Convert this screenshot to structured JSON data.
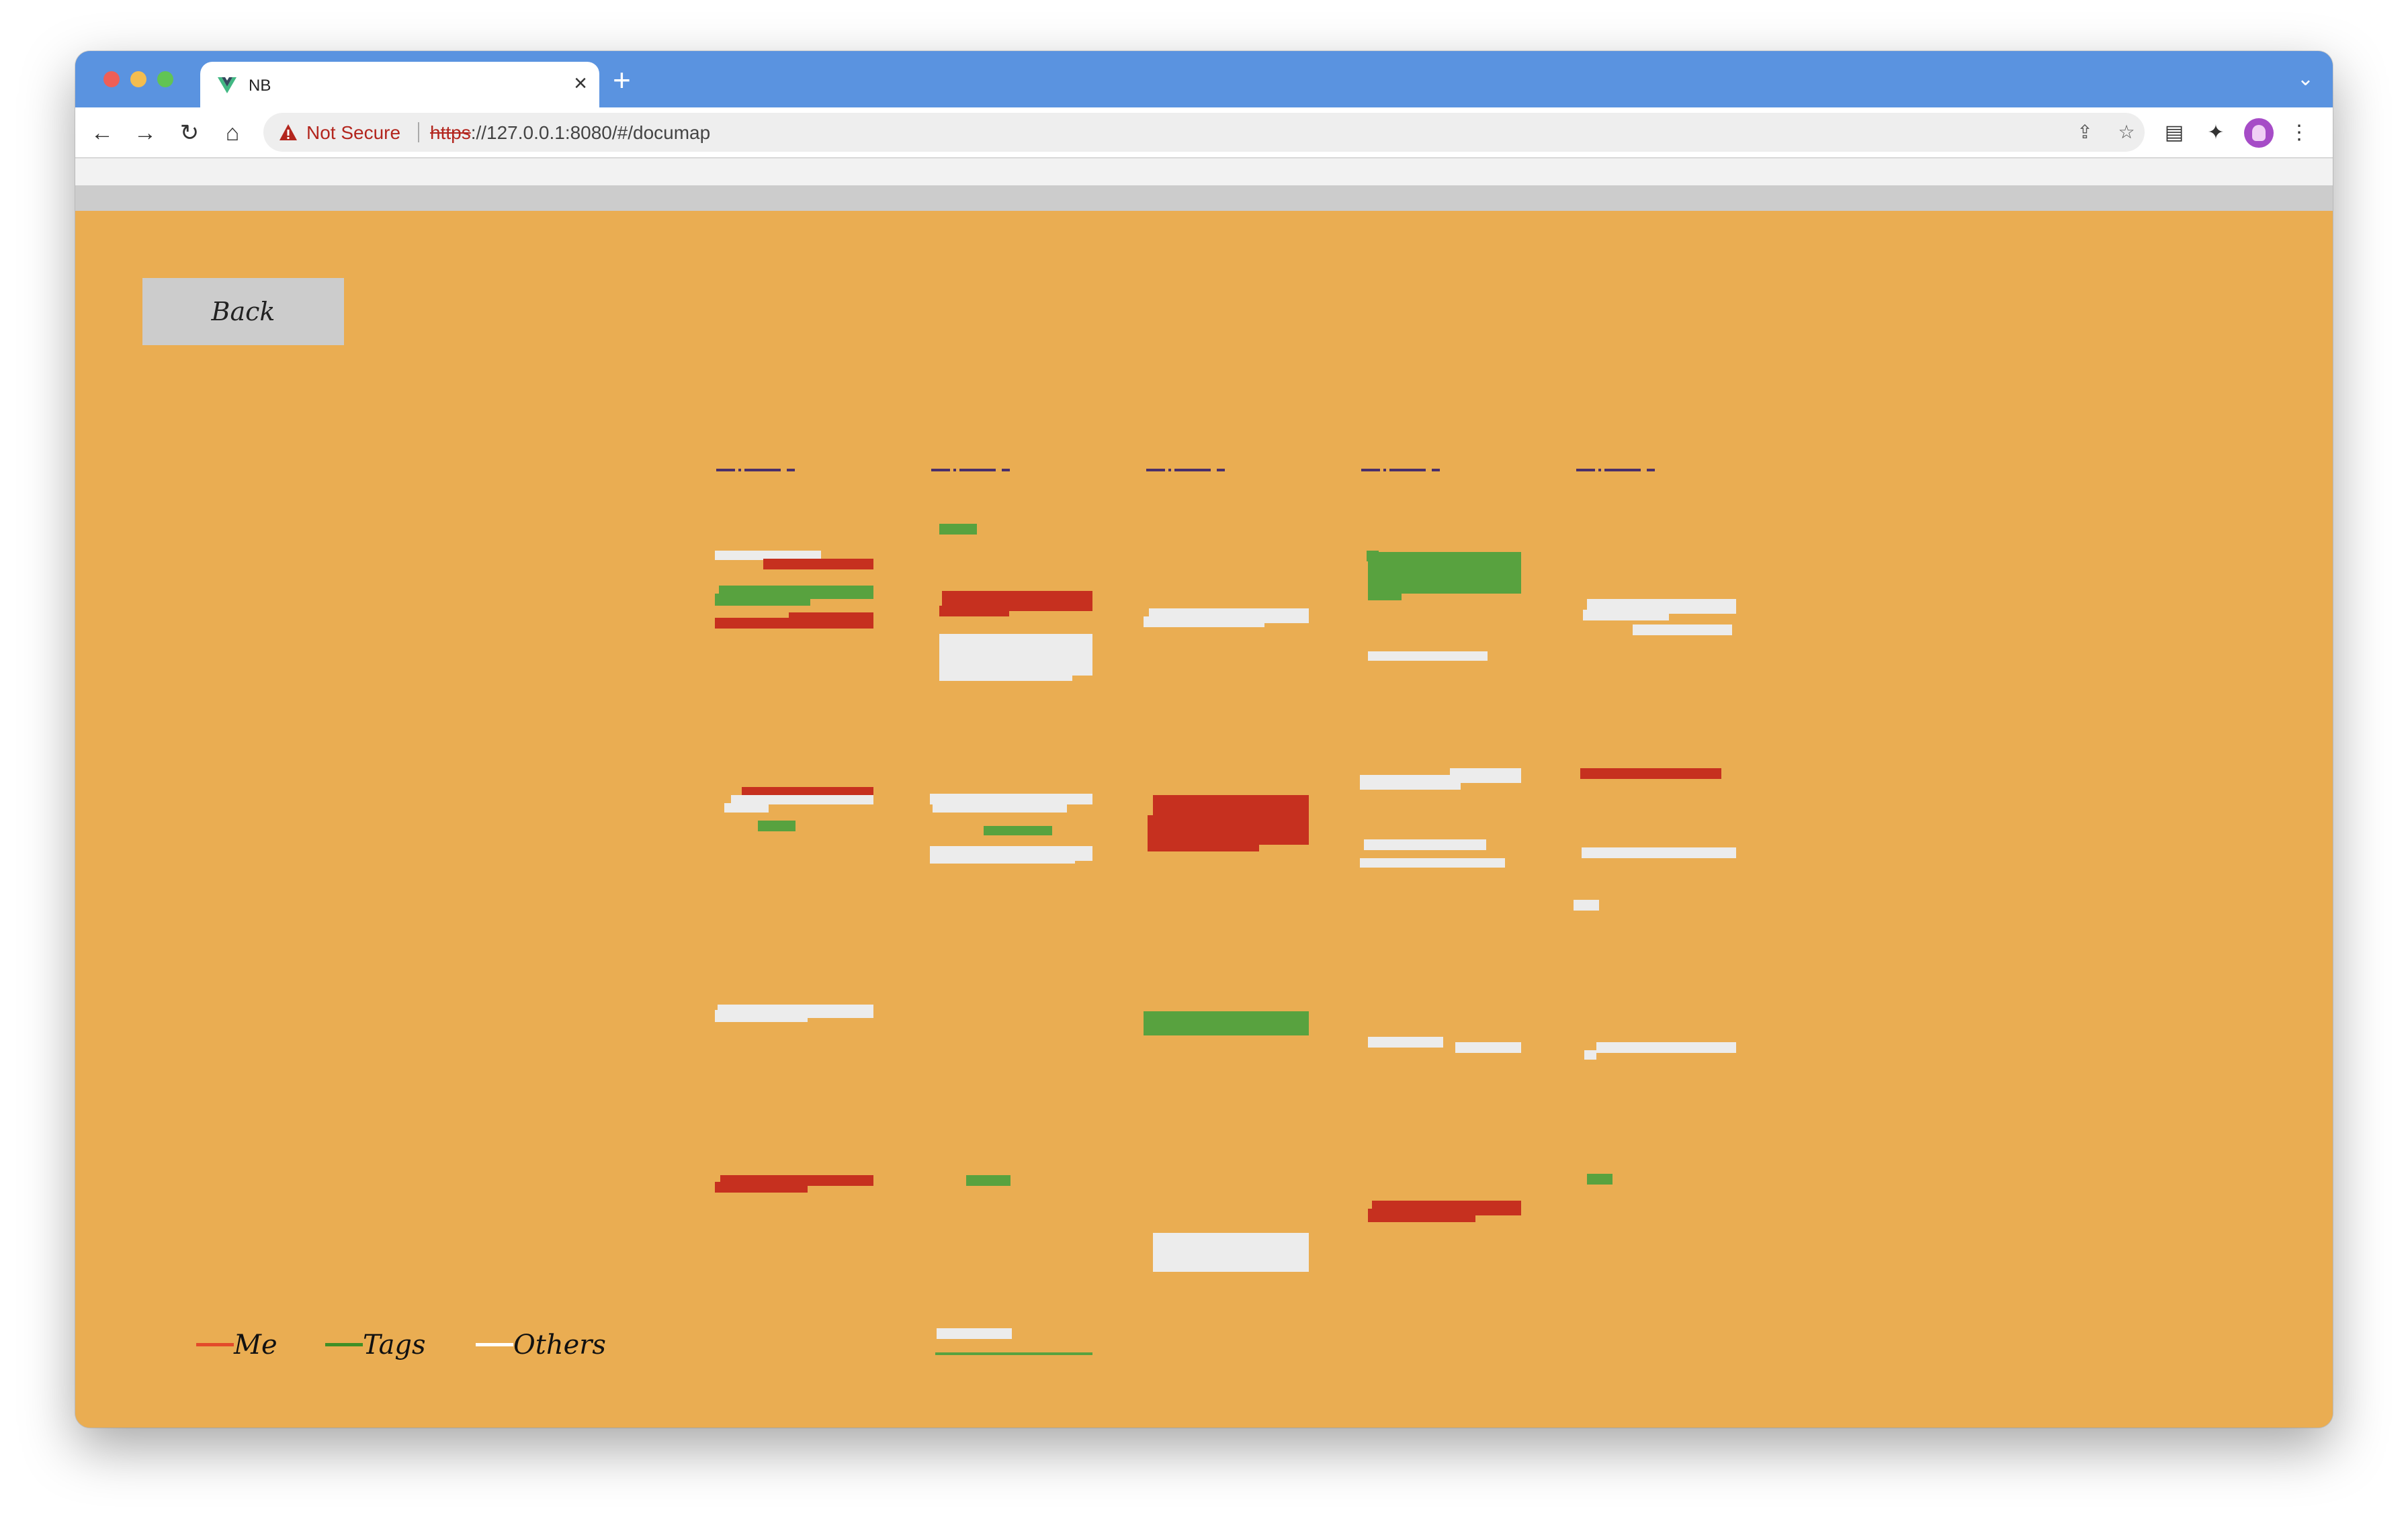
{
  "browser": {
    "tab_title": "NB",
    "tab_close": "×",
    "new_tab": "+",
    "tab_menu": "⌄",
    "security_label": "Not Secure",
    "url_scheme": "https",
    "url_rest": "://127.0.0.1:8080/#/documap",
    "icons": [
      "back-arrow-icon",
      "forward-arrow-icon",
      "reload-icon",
      "home-icon",
      "share-icon",
      "bookmark-star-icon",
      "reading-list-icon",
      "extensions-icon",
      "profile-avatar-icon",
      "more-menu-icon"
    ]
  },
  "page": {
    "back_label": "Back",
    "legend": [
      {
        "label": "Me",
        "color": "#e34a2a"
      },
      {
        "label": "Tags",
        "color": "#3f8f25"
      },
      {
        "label": "Others",
        "color": "#ffffff"
      }
    ]
  },
  "colors": {
    "background": "#eaad52",
    "me": "#c6301f",
    "tags": "#58a23f",
    "others": "#ececec",
    "header": "#4a2f6b"
  }
}
